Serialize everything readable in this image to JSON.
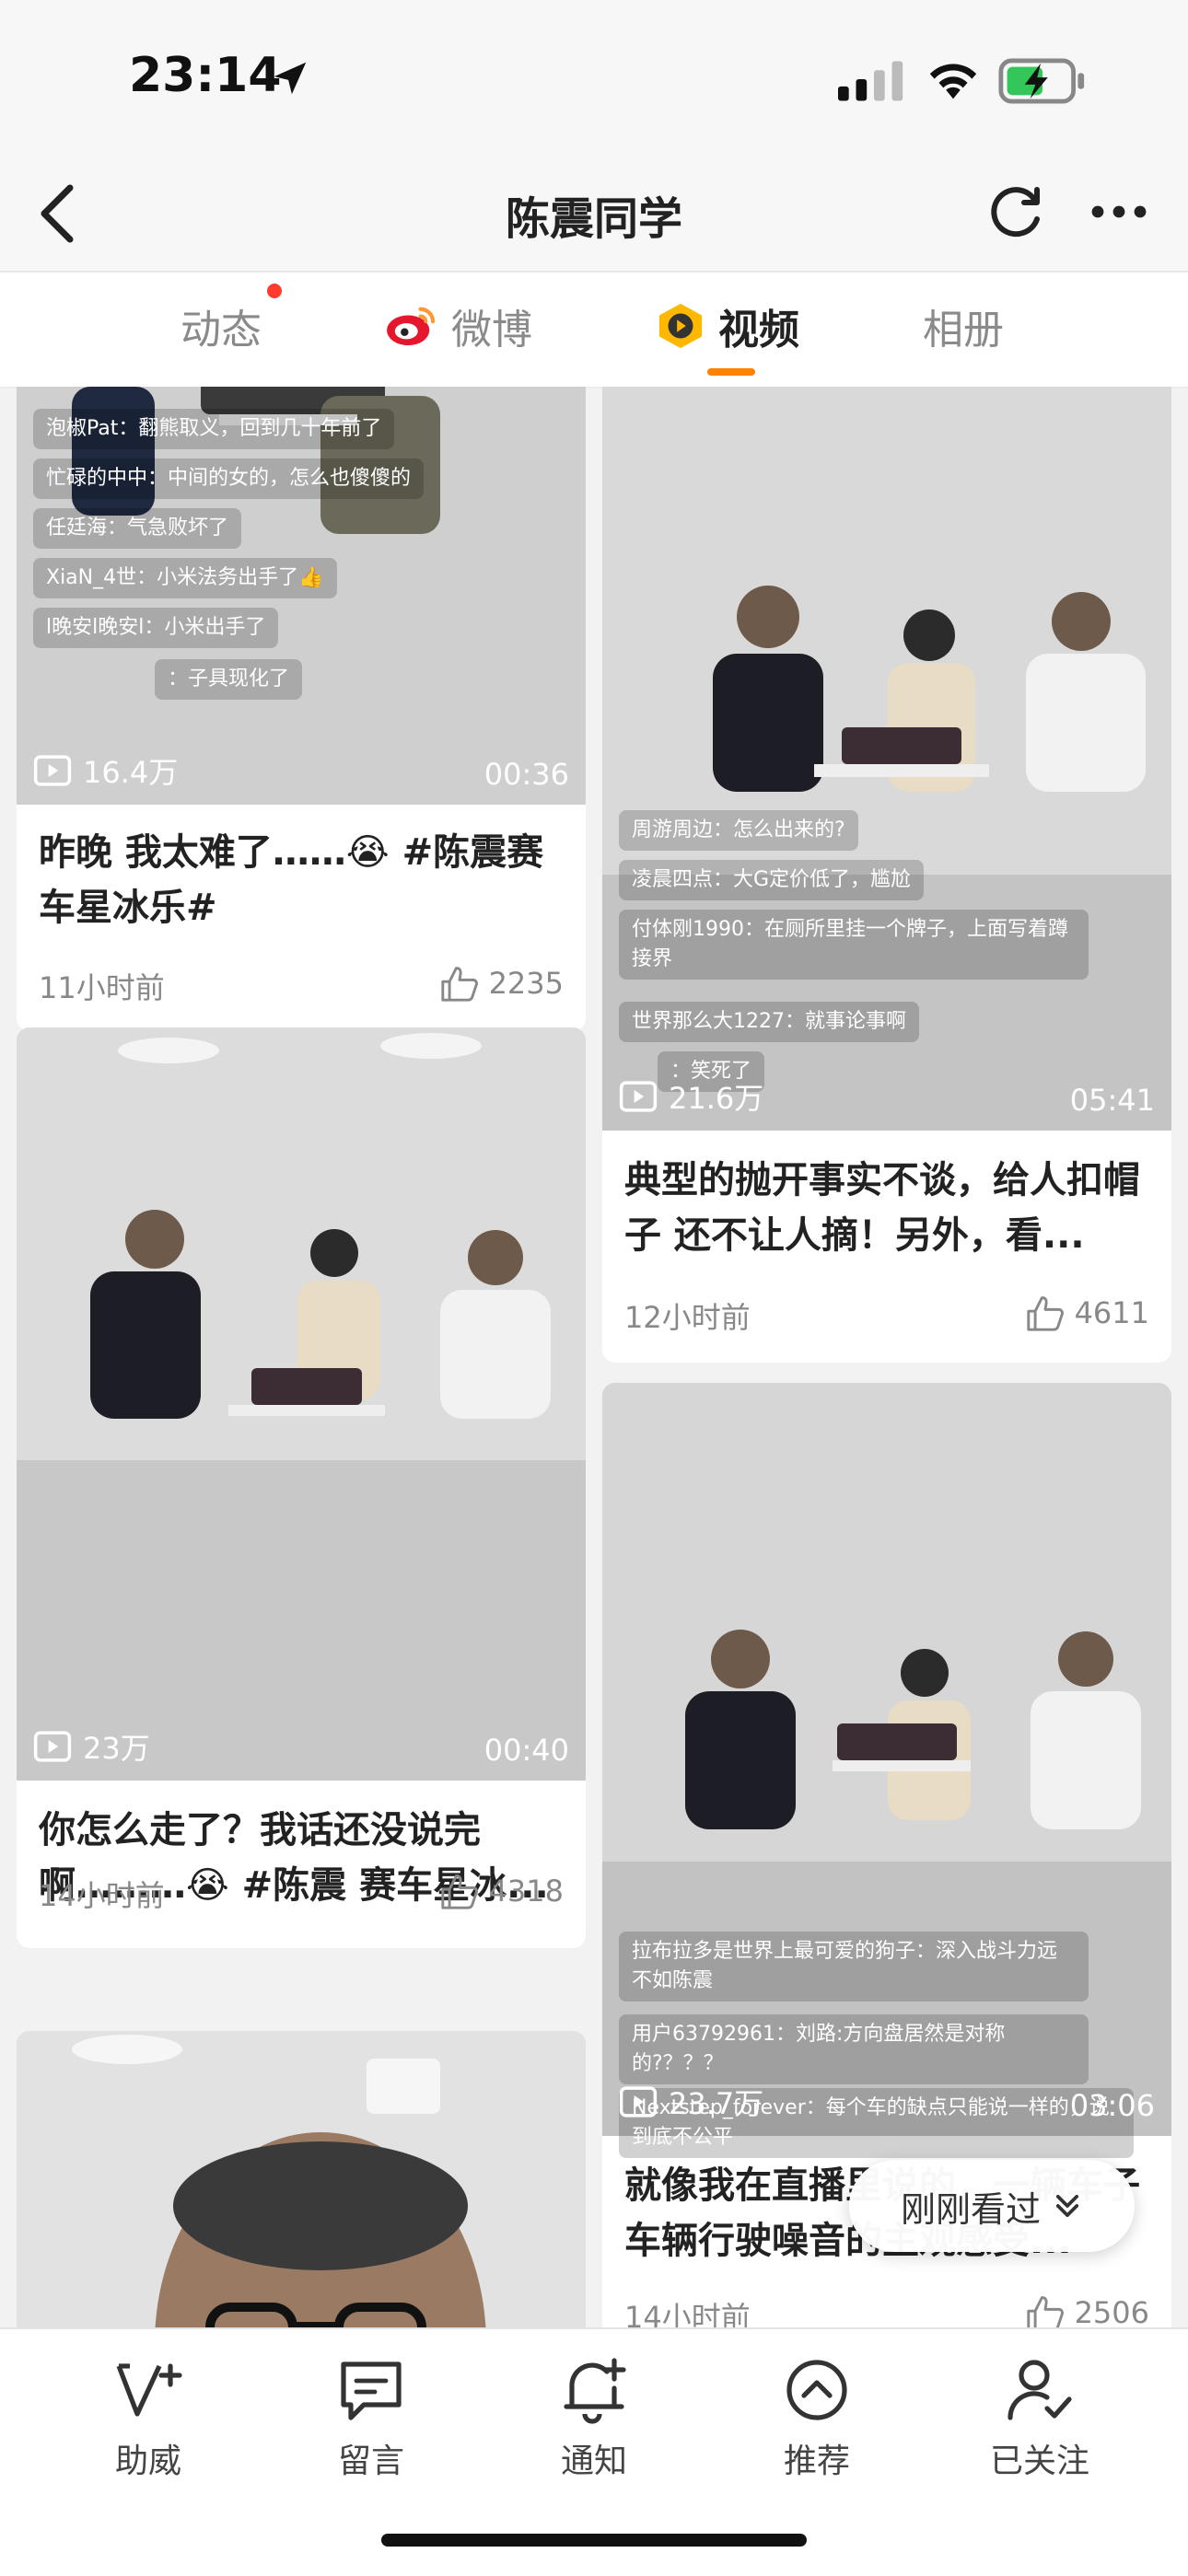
{
  "status": {
    "time": "23:14"
  },
  "nav": {
    "title": "陈震同学"
  },
  "tabs": [
    {
      "label": "动态"
    },
    {
      "label": "微博"
    },
    {
      "label": "视频"
    },
    {
      "label": "相册"
    }
  ],
  "feed": {
    "cards": [
      {
        "comments": [
          "泡椒Pat：翻熊取义，回到几十年前了",
          "忙碌的中中：中间的女的，怎么也傻傻的",
          "任廷海：气急败坏了",
          "XiaN_4世：小米法务出手了👍",
          "l晚安l晚安l：小米出手了",
          "：子具现化了"
        ],
        "views": "16.4万",
        "duration": "00:36",
        "caption": "昨晚 我太难了……😭 #陈震赛车星冰乐#",
        "time_ago": "11小时前",
        "likes": "2235"
      },
      {
        "comments": [
          "周游周边：怎么出来的?",
          "凌晨四点：大G定价低了，尴尬",
          "付体刚1990：在厕所里挂一个牌子，上面写着蹲接界",
          "世界那么大1227：就事论事啊",
          "：笑死了"
        ],
        "views": "21.6万",
        "duration": "05:41",
        "caption": "典型的抛开事实不谈，给人扣帽子 还不让人摘！另外，看...",
        "time_ago": "12小时前",
        "likes": "4611"
      },
      {
        "comments": [],
        "views": "23万",
        "duration": "00:40",
        "caption": "你怎么走了？我话还没说完啊………😭 #陈震 赛车星冰...",
        "time_ago": "14小时前",
        "likes": "4318"
      },
      {
        "comments": [
          "拉布拉多是世界上最可爱的狗子：深入战斗力远不如陈震",
          "用户63792961：刘路:方向盘居然是对称的?？？？",
          "Nextstep_forever：每个车的缺点只能说一样的，说到底不公平"
        ],
        "views": "23.7万",
        "duration": "03:06",
        "caption": "就像我在直播里说的，一辆车子车辆行驶噪音的主观感受...",
        "time_ago": "14小时前",
        "likes": "2506"
      }
    ]
  },
  "pill": {
    "label": "刚刚看过"
  },
  "bottom_bar": [
    {
      "label": "助威",
      "icon": "v-plus-icon"
    },
    {
      "label": "留言",
      "icon": "message-icon"
    },
    {
      "label": "通知",
      "icon": "bell-plus-icon"
    },
    {
      "label": "推荐",
      "icon": "up-circle-icon"
    },
    {
      "label": "已关注",
      "icon": "user-check-icon"
    }
  ]
}
